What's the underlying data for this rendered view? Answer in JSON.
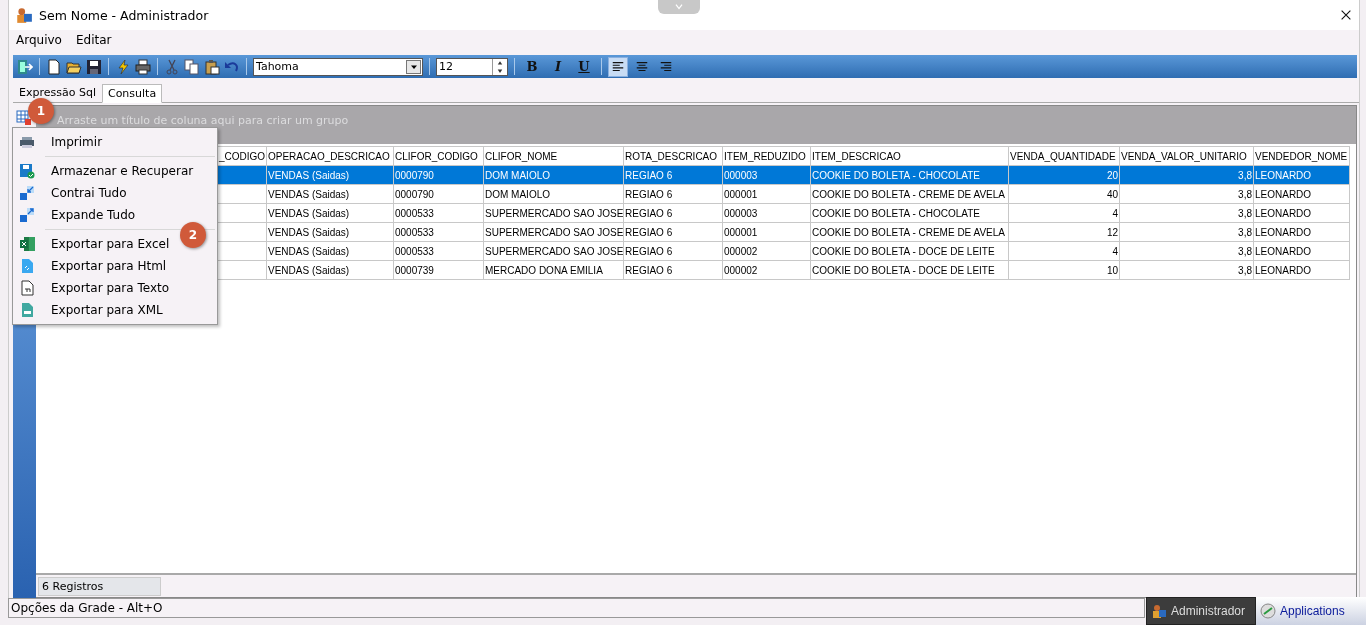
{
  "window": {
    "title": "Sem Nome - Administrador"
  },
  "menu": [
    "Arquivo",
    "Editar"
  ],
  "toolbar": {
    "font": "Tahoma",
    "font_size": "12",
    "format_buttons": [
      "B",
      "I",
      "U"
    ],
    "align": [
      {
        "kind": "left",
        "selected": true
      },
      {
        "kind": "center",
        "selected": false
      },
      {
        "kind": "right",
        "selected": false
      }
    ]
  },
  "tabs": [
    {
      "label": "Expressão Sql",
      "selected": false
    },
    {
      "label": "Consulta",
      "selected": true
    }
  ],
  "group_hint": "Arraste um título de coluna aqui para criar um grupo",
  "grid": {
    "columns": [
      {
        "label": "_CODIGO",
        "kind": "text"
      },
      {
        "label": "OPERACAO_DESCRICAO",
        "kind": "text"
      },
      {
        "label": "CLIFOR_CODIGO",
        "kind": "text"
      },
      {
        "label": "CLIFOR_NOME",
        "kind": "text"
      },
      {
        "label": "ROTA_DESCRICAO",
        "kind": "text"
      },
      {
        "label": "ITEM_REDUZIDO",
        "kind": "text"
      },
      {
        "label": "ITEM_DESCRICAO",
        "kind": "text"
      },
      {
        "label": "VENDA_QUANTIDADE",
        "kind": "number"
      },
      {
        "label": "VENDA_VALOR_UNITARIO",
        "kind": "number"
      },
      {
        "label": "VENDEDOR_NOME",
        "kind": "text"
      }
    ],
    "rows": [
      {
        "selected": true,
        "cells": [
          "",
          "VENDAS (Saidas)",
          "0000790",
          "DOM MAIOLO",
          "REGIAO 6",
          "000003",
          "COOKIE DO BOLETA - CHOCOLATE",
          "20",
          "3,8",
          "LEONARDO"
        ]
      },
      {
        "selected": false,
        "cells": [
          "",
          "VENDAS (Saidas)",
          "0000790",
          "DOM MAIOLO",
          "REGIAO 6",
          "000001",
          "COOKIE DO BOLETA - CREME DE AVELA",
          "40",
          "3,8",
          "LEONARDO"
        ]
      },
      {
        "selected": false,
        "cells": [
          "",
          "VENDAS (Saidas)",
          "0000533",
          "SUPERMERCADO SAO JOSE",
          "REGIAO 6",
          "000003",
          "COOKIE DO BOLETA - CHOCOLATE",
          "4",
          "3,8",
          "LEONARDO"
        ]
      },
      {
        "selected": false,
        "cells": [
          "",
          "VENDAS (Saidas)",
          "0000533",
          "SUPERMERCADO SAO JOSE",
          "REGIAO 6",
          "000001",
          "COOKIE DO BOLETA - CREME DE AVELA",
          "12",
          "3,8",
          "LEONARDO"
        ]
      },
      {
        "selected": false,
        "cells": [
          "",
          "VENDAS (Saidas)",
          "0000533",
          "SUPERMERCADO SAO JOSE",
          "REGIAO 6",
          "000002",
          "COOKIE DO BOLETA - DOCE DE LEITE",
          "4",
          "3,8",
          "LEONARDO"
        ]
      },
      {
        "selected": false,
        "cells": [
          "",
          "VENDAS (Saidas)",
          "0000739",
          "MERCADO DONA EMILIA",
          "REGIAO 6",
          "000002",
          "COOKIE DO BOLETA - DOCE DE LEITE",
          "10",
          "3,8",
          "LEONARDO"
        ]
      }
    ]
  },
  "record_count": "6 Registros",
  "context_menu": [
    {
      "kind": "print",
      "label": "Imprimir"
    },
    {
      "kind": "separator"
    },
    {
      "kind": "save",
      "label": "Armazenar e Recuperar"
    },
    {
      "kind": "collapse",
      "label": "Contrai Tudo"
    },
    {
      "kind": "expand",
      "label": "Expande Tudo"
    },
    {
      "kind": "separator"
    },
    {
      "kind": "excel",
      "label": "Exportar para Excel"
    },
    {
      "kind": "html",
      "label": "Exportar para Html"
    },
    {
      "kind": "text",
      "label": "Exportar para Texto"
    },
    {
      "kind": "xml",
      "label": "Exportar para XML"
    }
  ],
  "badges": [
    "1",
    "2"
  ],
  "status_bar": "Opções da Grade - Alt+O",
  "taskbar": [
    {
      "label": "Administrador",
      "selected": true
    },
    {
      "label": "Applications",
      "selected": false
    }
  ]
}
